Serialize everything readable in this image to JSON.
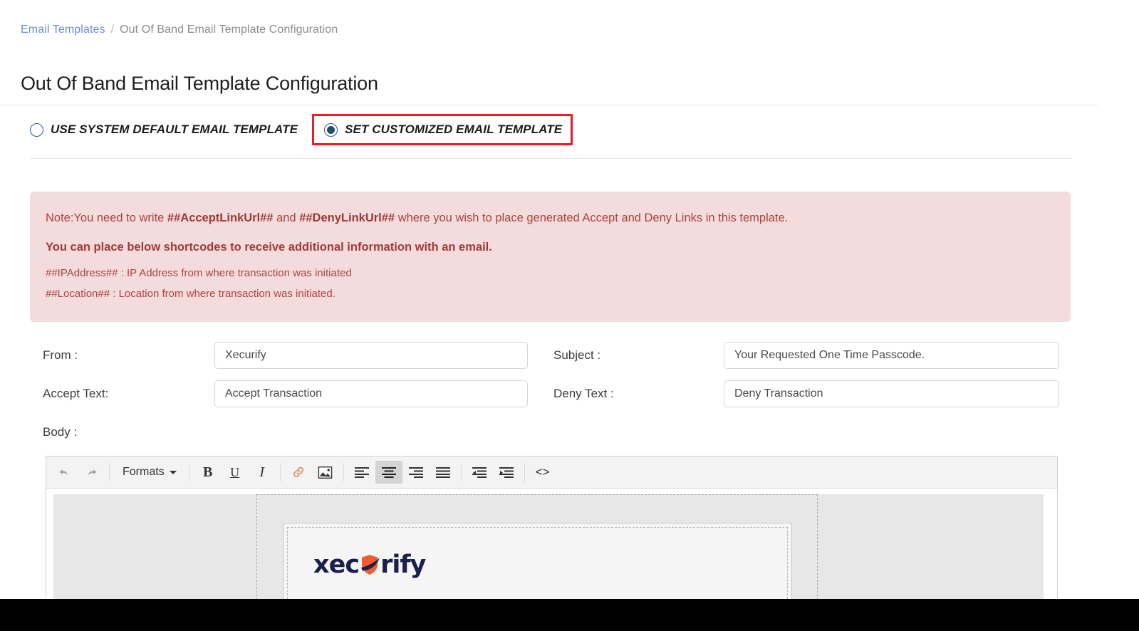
{
  "breadcrumb": {
    "parent": "Email Templates",
    "separator": "/",
    "current": "Out Of Band Email Template Configuration"
  },
  "page": {
    "title": "Out Of Band Email Template Configuration"
  },
  "template_mode": {
    "options": [
      {
        "label": "USE SYSTEM DEFAULT EMAIL TEMPLATE",
        "selected": false,
        "highlighted": false
      },
      {
        "label": "SET CUSTOMIZED EMAIL TEMPLATE",
        "selected": true,
        "highlighted": true
      }
    ],
    "highlight_color": "#ee1c25",
    "radio_color": "#1f4e79"
  },
  "note": {
    "background": "#f4dcdc",
    "text_color": "#a94442",
    "line1_prefix": "Note:You need to write ",
    "line1_code1": "##AcceptLinkUrl##",
    "line1_mid": " and ",
    "line1_code2": "##DenyLinkUrl##",
    "line1_suffix": " where you wish to place generated Accept and Deny Links in this template.",
    "strong": "You can place below shortcodes to receive additional information with an email.",
    "shortcode1": "##IPAddress## : IP Address from where transaction was initiated",
    "shortcode2": "##Location## : Location from where transaction was initiated."
  },
  "form": {
    "from": {
      "label": "From :",
      "value": "Xecurify",
      "placeholder": "Xecurify"
    },
    "subject": {
      "label": "Subject :",
      "value": "Your Requested One Time Passcode.",
      "placeholder": "Subject"
    },
    "accept_text": {
      "label": "Accept Text:",
      "value": "Accept Transaction",
      "placeholder": "Accept Transaction"
    },
    "deny_text": {
      "label": "Deny Text :",
      "value": "Deny Transaction",
      "placeholder": "Deny Transaction"
    },
    "body": {
      "label": "Body :"
    }
  },
  "editor": {
    "toolbar": {
      "undo": "undo-icon",
      "redo": "redo-icon",
      "formats_label": "Formats",
      "bold": "B",
      "underline": "U",
      "italic": "I",
      "link": "link-icon",
      "image": "image-icon",
      "align_left": "align-left-icon",
      "align_center": "align-center-icon",
      "align_right": "align-right-icon",
      "align_justify": "align-justify-icon",
      "outdent": "outdent-icon",
      "indent": "indent-icon",
      "source_code": "<>",
      "active_button": "align-center-icon"
    },
    "content": {
      "logo_text_1": "xec",
      "logo_text_2": "rify",
      "logo_mark_color": "#ef5b32",
      "logo_text_color": "#1a1f4b"
    }
  }
}
